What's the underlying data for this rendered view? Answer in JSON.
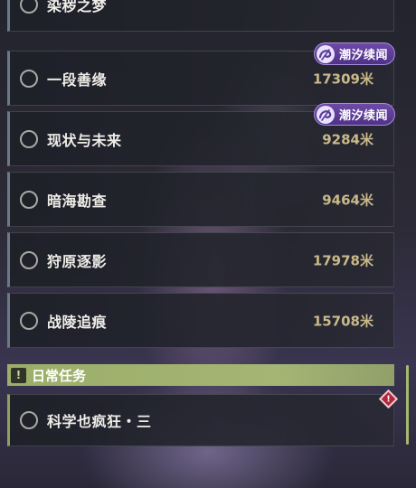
{
  "quests": [
    {
      "name": "染秽之梦",
      "distance": "",
      "tag": ""
    },
    {
      "name": "一段善缘",
      "distance": "17309米",
      "tag": "潮汐续闻"
    },
    {
      "name": "现状与未来",
      "distance": "9284米",
      "tag": "潮汐续闻"
    },
    {
      "name": "暗海勘查",
      "distance": "9464米",
      "tag": ""
    },
    {
      "name": "狩原逐影",
      "distance": "17978米",
      "tag": ""
    },
    {
      "name": "战陵追痕",
      "distance": "15708米",
      "tag": ""
    }
  ],
  "daily_section": {
    "title": "日常任务",
    "icon": "!",
    "items": [
      {
        "name": "科学也疯狂・三"
      }
    ]
  },
  "alert_icon": "!",
  "colors": {
    "tag_purple": "#5b3b96",
    "distance_gold": "#c9b98a",
    "daily_green": "#9cae6a",
    "alert_red": "#b0273b"
  }
}
